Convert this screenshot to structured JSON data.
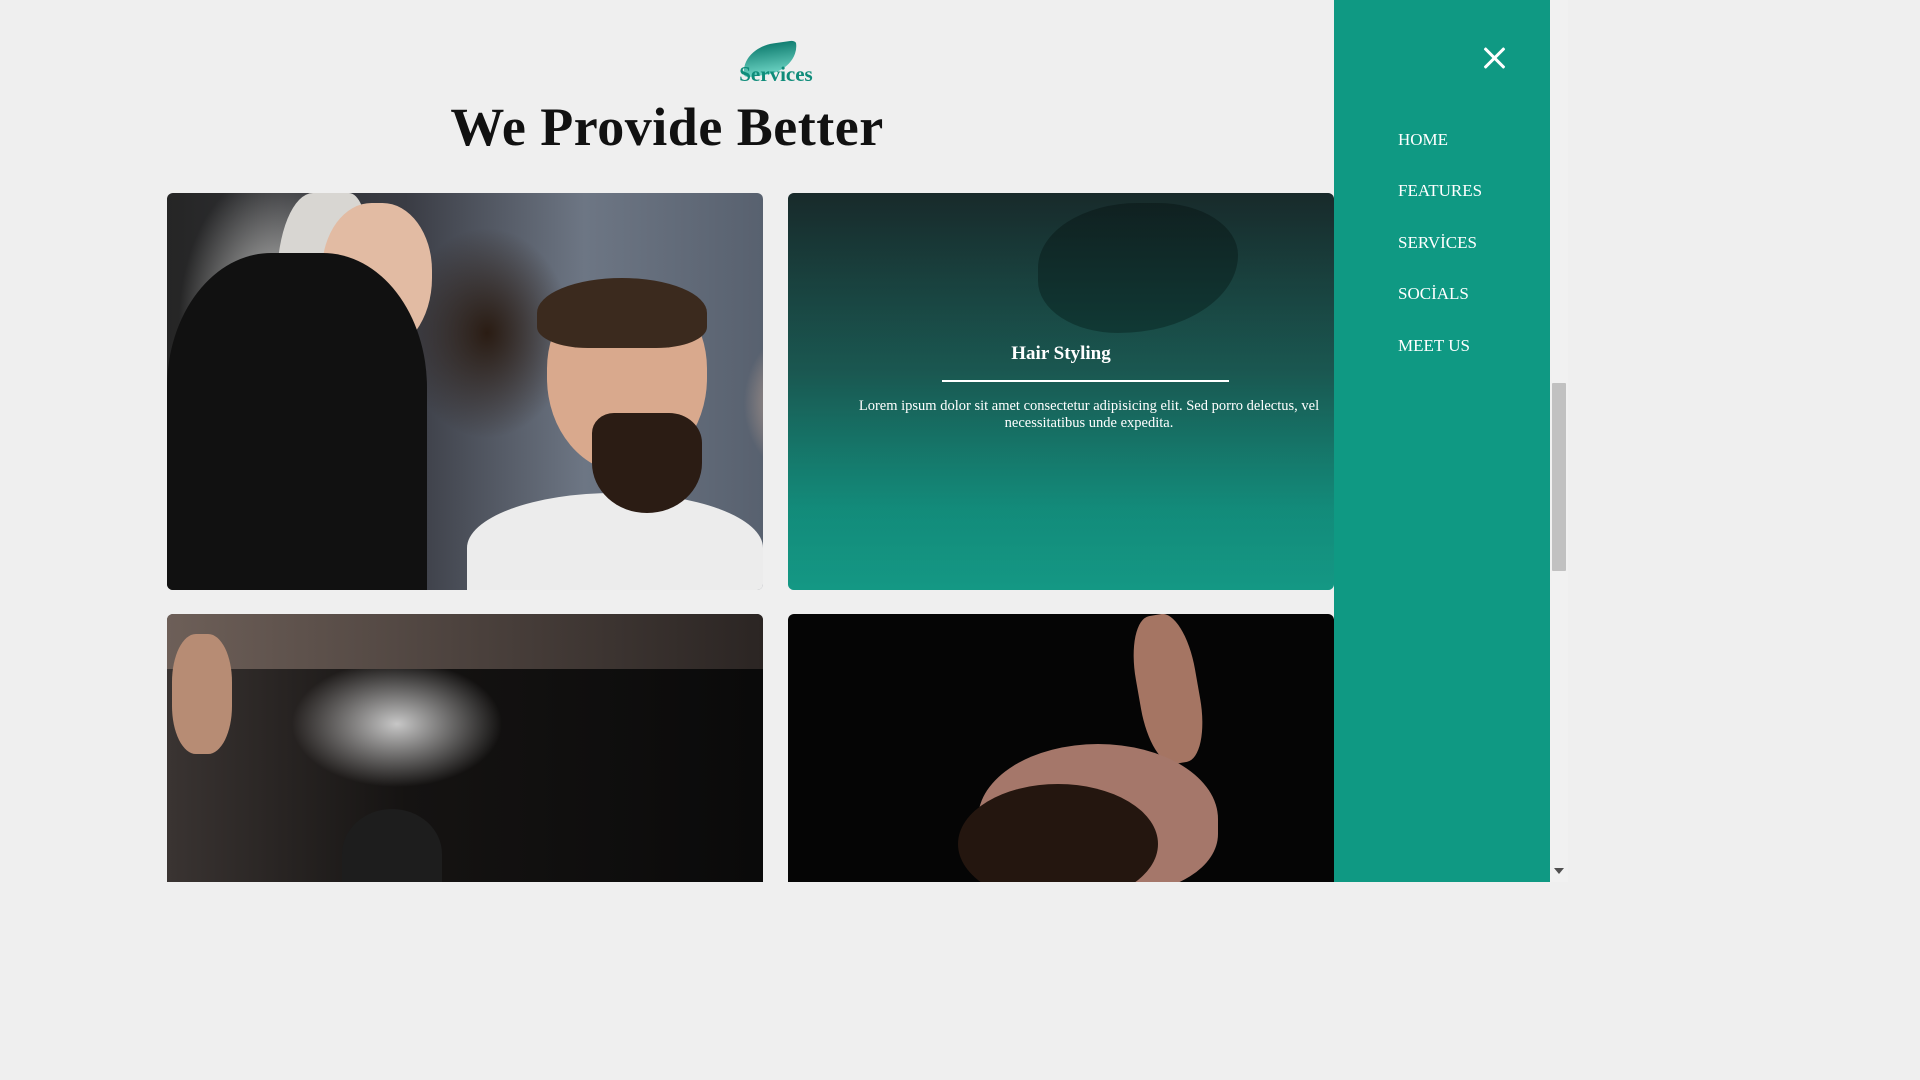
{
  "section": {
    "badge": "Services",
    "heading": "We Provide Better"
  },
  "cards": [
    {
      "image": "stylist-cutting-hair-photo"
    },
    {
      "image": "beard-trim-photo",
      "title": "Hair Styling",
      "description": "Lorem ipsum dolor sit amet consectetur adipisicing elit. Sed porro delectus, vel necessitatibus unde expedita."
    },
    {
      "image": "hair-spray-photo"
    },
    {
      "image": "hair-wash-photo"
    }
  ],
  "menu": {
    "close_icon": "close-icon",
    "items": [
      "HOME",
      "FEATURES",
      "SERVİCES",
      "SOCİALS",
      "MEET US"
    ]
  },
  "colors": {
    "accent": "#0f9983",
    "background": "#efefef"
  }
}
